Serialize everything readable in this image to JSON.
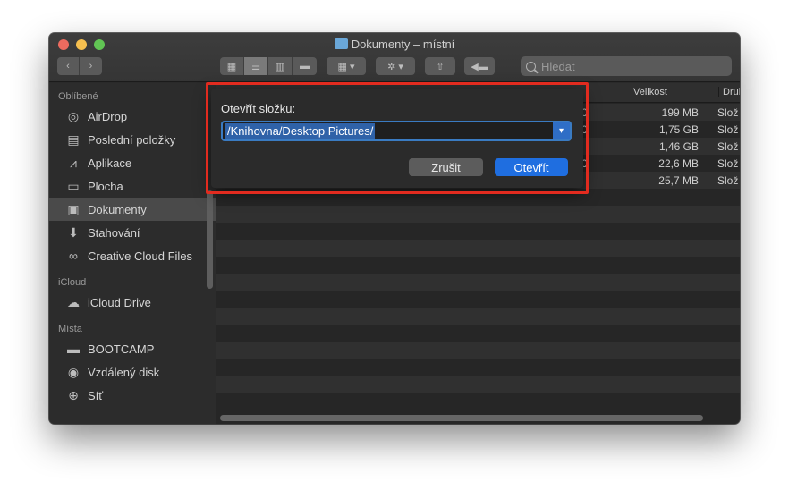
{
  "window": {
    "title": "Dokumenty – místní"
  },
  "search": {
    "placeholder": "Hledat"
  },
  "sidebar": {
    "sections": [
      {
        "label": "Oblíbené"
      },
      {
        "label": "iCloud"
      },
      {
        "label": "Místa"
      }
    ],
    "favorites": [
      {
        "label": "AirDrop",
        "icon": "airdrop-icon"
      },
      {
        "label": "Poslední položky",
        "icon": "recents-icon"
      },
      {
        "label": "Aplikace",
        "icon": "applications-icon"
      },
      {
        "label": "Plocha",
        "icon": "desktop-icon"
      },
      {
        "label": "Dokumenty",
        "icon": "documents-icon"
      },
      {
        "label": "Stahování",
        "icon": "downloads-icon"
      },
      {
        "label": "Creative Cloud Files",
        "icon": "creative-cloud-icon"
      }
    ],
    "icloud": [
      {
        "label": "iCloud Drive",
        "icon": "cloud-icon"
      }
    ],
    "locations": [
      {
        "label": "BOOTCAMP",
        "icon": "disk-icon"
      },
      {
        "label": "Vzdálený disk",
        "icon": "remote-disc-icon"
      },
      {
        "label": "Síť",
        "icon": "network-icon"
      }
    ]
  },
  "table": {
    "columns": {
      "size": "Velikost",
      "kind": "Druh"
    },
    "rows": [
      {
        "date": "0",
        "size": "199 MB",
        "kind": "Slož"
      },
      {
        "date": "0",
        "size": "1,75 GB",
        "kind": "Slož"
      },
      {
        "date": "",
        "size": "1,46 GB",
        "kind": "Slož"
      },
      {
        "date": "0",
        "size": "22,6 MB",
        "kind": "Slož"
      },
      {
        "date": "",
        "size": "25,7 MB",
        "kind": "Slož"
      }
    ]
  },
  "dialog": {
    "label": "Otevřít složku:",
    "path_value": "/Knihovna/Desktop Pictures/",
    "cancel_label": "Zrušit",
    "open_label": "Otevřít"
  },
  "colors": {
    "highlight": "#e22b1f",
    "accent": "#1f6ee0"
  }
}
